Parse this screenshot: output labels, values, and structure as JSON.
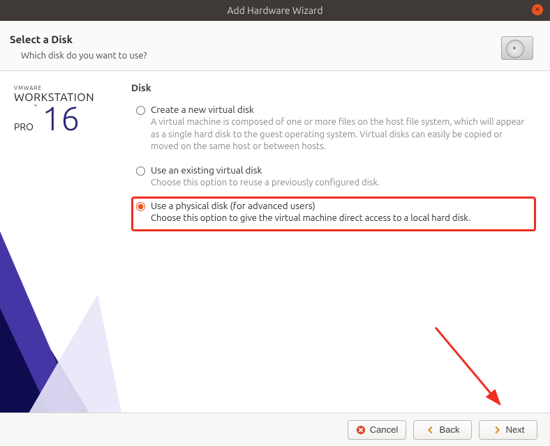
{
  "window": {
    "title": "Add Hardware Wizard"
  },
  "header": {
    "title": "Select a Disk",
    "subtitle": "Which disk do you want to use?"
  },
  "logo": {
    "brand": "VMWARE",
    "product": "WORKSTATION",
    "edition": "PRO",
    "version": "16"
  },
  "section": {
    "heading": "Disk",
    "options": [
      {
        "label": "Create a new virtual disk",
        "desc": "A virtual machine is composed of one or more files on the host file system, which will appear as a single hard disk to the guest operating system. Virtual disks can easily be copied or moved on the same host or between hosts.",
        "selected": false,
        "highlighted": false
      },
      {
        "label": "Use an existing virtual disk",
        "desc": "Choose this option to reuse a previously configured disk.",
        "selected": false,
        "highlighted": false
      },
      {
        "label": "Use a physical disk (for advanced users)",
        "desc": "Choose this option to give the virtual machine direct access to a local hard disk.",
        "selected": true,
        "highlighted": true
      }
    ]
  },
  "buttons": {
    "cancel": "Cancel",
    "back": "Back",
    "next": "Next"
  }
}
